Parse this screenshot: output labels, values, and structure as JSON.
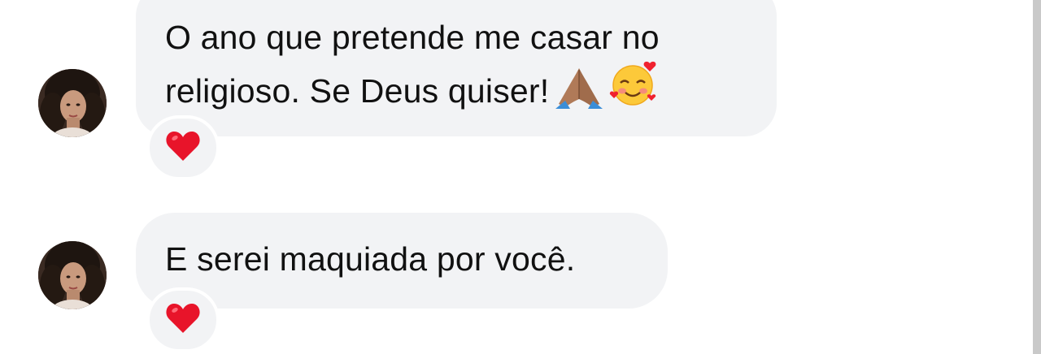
{
  "messages": [
    {
      "lines": [
        "O ano que pretende me casar no",
        "religioso. Se Deus quiser!"
      ],
      "emojis": [
        "praying-hands-icon",
        "smiling-face-with-hearts-icon"
      ],
      "reaction": "heart-icon"
    },
    {
      "lines": [
        "E serei maquiada por você."
      ],
      "reaction": "heart-icon"
    }
  ],
  "colors": {
    "bubble": "#f2f3f5",
    "text": "#111111",
    "heart": "#e8142a",
    "background": "#ffffff"
  }
}
